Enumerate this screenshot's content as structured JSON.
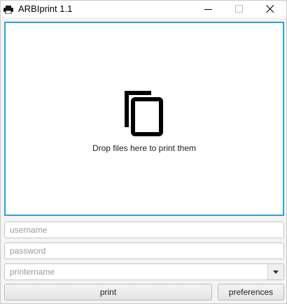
{
  "window": {
    "title": "ARBIprint 1.1",
    "app_icon": "printer-icon",
    "controls": [
      "minimize-icon",
      "maximize-icon",
      "close-icon"
    ]
  },
  "dropzone": {
    "icon": "copy-icon",
    "text": "Drop files here to print them",
    "border_color": "#27a5d8"
  },
  "form": {
    "username": {
      "placeholder": "username",
      "value": ""
    },
    "password": {
      "placeholder": "password",
      "value": ""
    },
    "printername": {
      "placeholder": "printername",
      "value": ""
    }
  },
  "buttons": {
    "print": "print",
    "preferences": "preferences"
  }
}
